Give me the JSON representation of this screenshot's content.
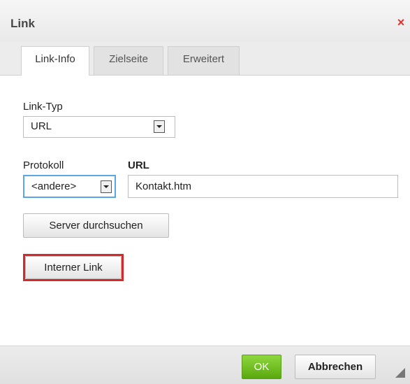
{
  "dialog": {
    "title": "Link",
    "close_symbol": "×"
  },
  "tabs": [
    {
      "label": "Link-Info",
      "active": true
    },
    {
      "label": "Zielseite",
      "active": false
    },
    {
      "label": "Erweitert",
      "active": false
    }
  ],
  "link_type": {
    "label": "Link-Typ",
    "value": "URL"
  },
  "protocol": {
    "label": "Protokoll",
    "value": "<andere>"
  },
  "url": {
    "label": "URL",
    "value": "Kontakt.htm"
  },
  "buttons": {
    "browse_server": "Server durchsuchen",
    "internal_link": "Interner Link",
    "ok": "OK",
    "cancel": "Abbrechen"
  },
  "colors": {
    "highlight": "#d42a2a",
    "ok_green": "#6cbf1f",
    "close_red": "#dd3333"
  },
  "icons": {
    "close": "close-icon",
    "dropdown": "chevron-down-icon",
    "resize": "resize-grip-icon"
  }
}
